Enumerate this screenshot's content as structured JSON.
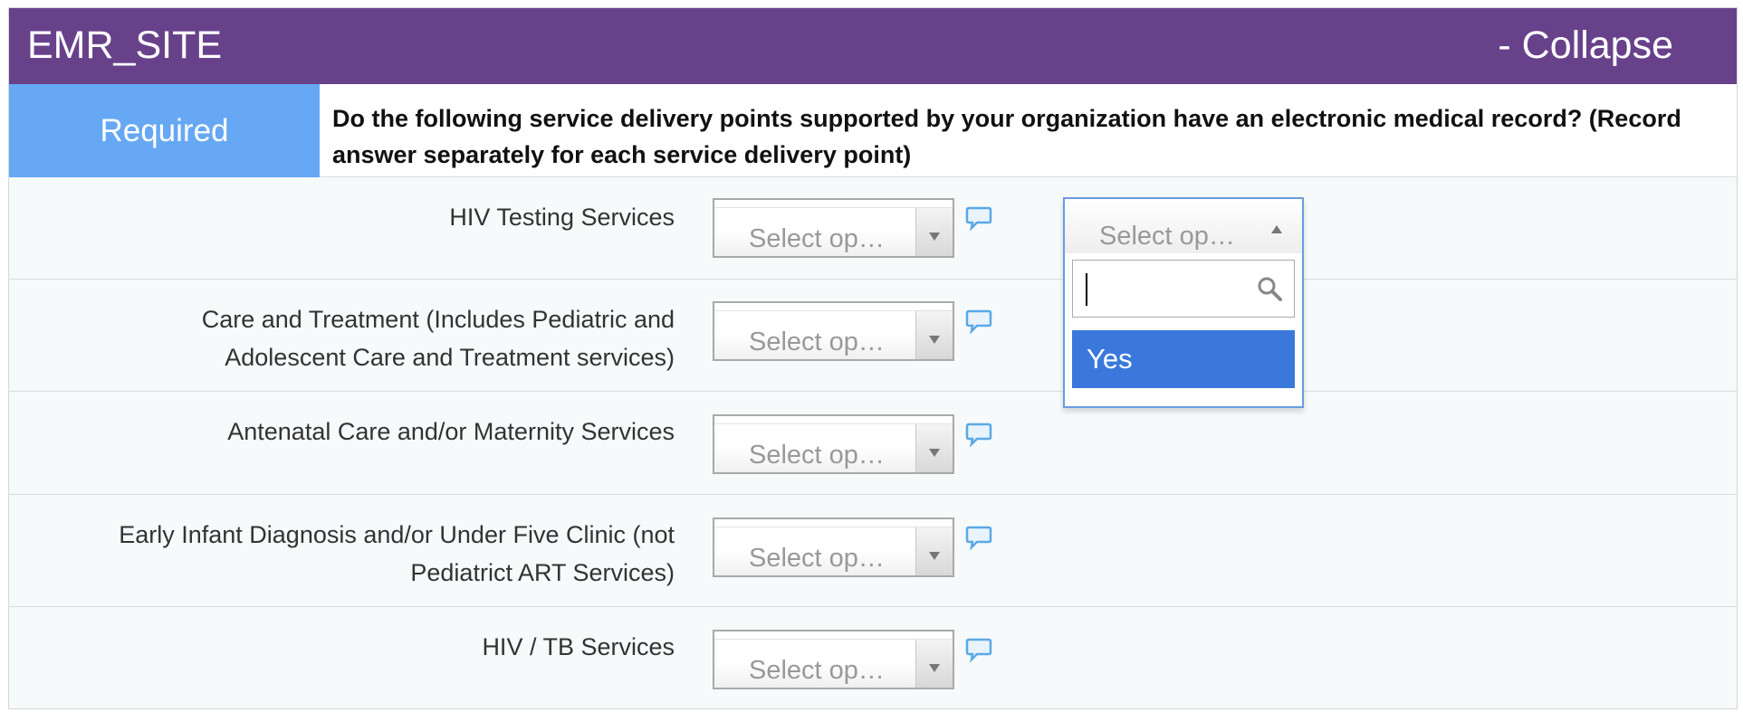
{
  "header": {
    "title": "EMR_SITE",
    "collapse_label": "- Collapse"
  },
  "required": {
    "label": "Required",
    "question": "Do the following service delivery points supported by your organization have an electronic medical record? (Record answer separately for each service delivery point)"
  },
  "questions": [
    {
      "label_line1": "HIV Testing Services",
      "label_line2": "",
      "select_placeholder": "Select op…"
    },
    {
      "label_line1": "Care and Treatment (Includes Pediatric and",
      "label_line2": "Adolescent Care and Treatment services)",
      "select_placeholder": "Select op…"
    },
    {
      "label_line1": "Antenatal Care and/or Maternity Services",
      "label_line2": "",
      "select_placeholder": "Select op…"
    },
    {
      "label_line1": "Early Infant Diagnosis and/or Under Five Clinic (not",
      "label_line2": "Pediatrict ART Services)",
      "select_placeholder": "Select op…"
    },
    {
      "label_line1": "HIV / TB Services",
      "label_line2": "",
      "select_placeholder": "Select op…"
    }
  ],
  "dropdown": {
    "placeholder": "Select op…",
    "search_value": "",
    "options": [
      "Yes"
    ],
    "highlighted_option": "Yes"
  },
  "colors": {
    "header_bg": "#68418b",
    "required_bg": "#66a8f4",
    "option_highlight": "#3b78dc",
    "comment_icon": "#5aa9e6"
  },
  "icons": {
    "comment": "comment-bubble-icon",
    "search": "search-icon",
    "select_arrow": "chevron-down-icon",
    "dropdown_arrow": "chevron-up-icon"
  }
}
